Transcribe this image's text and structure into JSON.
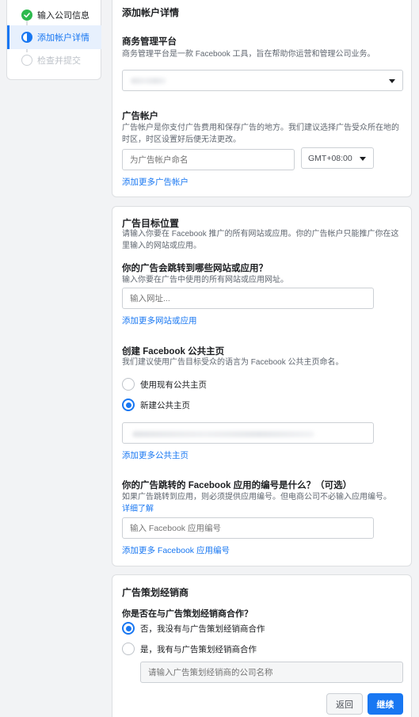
{
  "stepper": {
    "steps": [
      {
        "label": "输入公司信息",
        "state": "done"
      },
      {
        "label": "添加帐户详情",
        "state": "active"
      },
      {
        "label": "检查并提交",
        "state": "todo"
      }
    ]
  },
  "account_card": {
    "title": "添加帐户详情",
    "biz_platform": {
      "title": "商务管理平台",
      "desc": "商务管理平台是一款 Facebook 工具，旨在帮助你运营和管理公司业务。"
    },
    "ad_account": {
      "title": "广告帐户",
      "desc": "广告帐户是你支付广告费用和保存广告的地方。我们建议选择广告受众所在地的时区，时区设置好后便无法更改。",
      "name_placeholder": "为广告帐户命名",
      "timezone": "GMT+08:00",
      "add_link": "添加更多广告帐户"
    }
  },
  "destination_card": {
    "title": "广告目标位置",
    "desc": "请输入你要在 Facebook 推广的所有网站或应用。你的广告帐户只能推广你在这里输入的网站或应用。",
    "website": {
      "question": "你的广告会跳转到哪些网站或应用？",
      "hint": "输入你要在广告中使用的所有网站或应用网址。",
      "placeholder": "输入网址...",
      "add_link": "添加更多网站或应用"
    },
    "page": {
      "title": "创建 Facebook 公共主页",
      "hint": "我们建议使用广告目标受众的语言为 Facebook 公共主页命名。",
      "option_existing": "使用现有公共主页",
      "option_new": "新建公共主页",
      "selected": "new",
      "add_link": "添加更多公共主页"
    },
    "app": {
      "question": "你的广告跳转的 Facebook 应用的编号是什么？（可选）",
      "hint": "如果广告跳转到应用，则必须提供应用编号。但电商公司不必输入应用编号。",
      "learn_more": "详细了解",
      "placeholder": "输入 Facebook 应用编号",
      "add_link": "添加更多 Facebook 应用编号"
    }
  },
  "agency_card": {
    "title": "广告策划经销商",
    "question": "你是否在与广告策划经销商合作？",
    "option_no": "否，我没有与广告策划经销商合作",
    "option_yes": "是，我有与广告策划经销商合作",
    "selected": "no",
    "agency_placeholder": "请输入广告策划经销商的公司名称",
    "back_label": "返回",
    "next_label": "继续"
  },
  "colors": {
    "accent": "#1877f2",
    "success": "#2dba4e",
    "background": "#f2f3f5"
  }
}
